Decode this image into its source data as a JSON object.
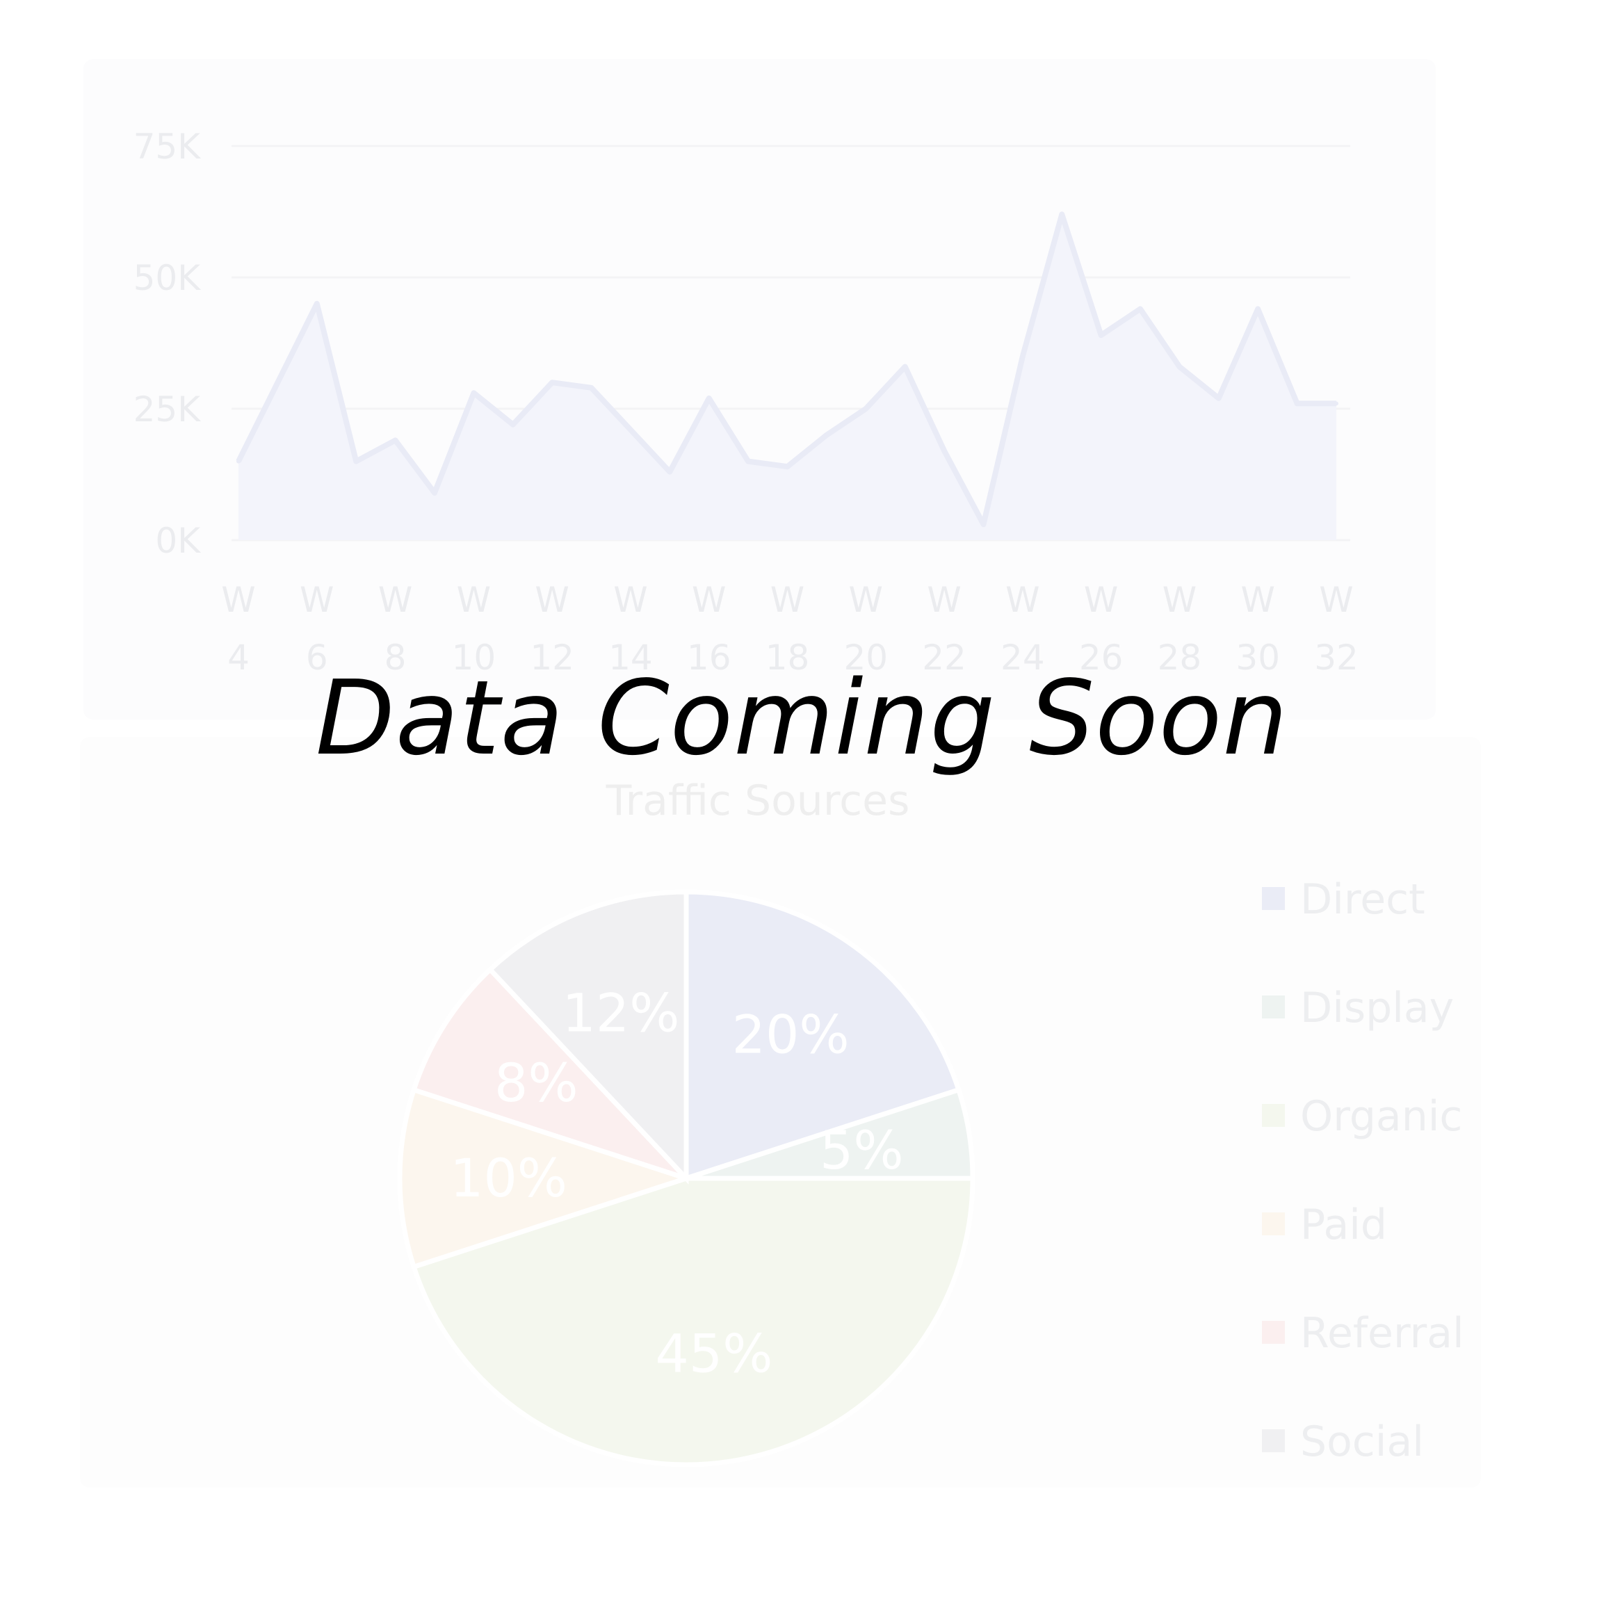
{
  "overlay_message": "Data Coming Soon",
  "chart_data": [
    {
      "type": "area",
      "y_ticks": [
        "0K",
        "25K",
        "50K",
        "75K"
      ],
      "ylim": [
        0,
        75000
      ],
      "x_prefix": "W",
      "x_tick_values": [
        4,
        6,
        8,
        10,
        12,
        14,
        16,
        18,
        20,
        22,
        24,
        26,
        28,
        30,
        32
      ],
      "x": [
        4,
        5,
        6,
        7,
        8,
        9,
        10,
        11,
        12,
        13,
        14,
        15,
        16,
        17,
        18,
        19,
        20,
        21,
        22,
        23,
        24,
        25,
        26,
        27,
        28,
        29,
        30,
        31,
        32
      ],
      "values": [
        15000,
        30000,
        45000,
        15000,
        19000,
        9000,
        28000,
        22000,
        30000,
        29000,
        21000,
        13000,
        27000,
        15000,
        14000,
        20000,
        25000,
        33000,
        17000,
        3000,
        35000,
        62000,
        39000,
        44000,
        33000,
        27000,
        44000,
        26000,
        26000
      ],
      "grid": true,
      "colors": {
        "fill": "#f3f4fb",
        "line": "#e9ebf6",
        "grid": "#f3f3f5"
      }
    },
    {
      "type": "pie",
      "subtitle": "Traffic Sources",
      "slices": [
        {
          "name": "Direct",
          "value": 20,
          "label": "20%",
          "color": "#eaecf6"
        },
        {
          "name": "Display",
          "value": 5,
          "label": "5%",
          "color": "#eef3f1"
        },
        {
          "name": "Organic",
          "value": 45,
          "label": "45%",
          "color": "#f4f7ee"
        },
        {
          "name": "Paid",
          "value": 10,
          "label": "10%",
          "color": "#fcf6ee"
        },
        {
          "name": "Referral",
          "value": 8,
          "label": "8%",
          "color": "#fbefef"
        },
        {
          "name": "Social",
          "value": 12,
          "label": "12%",
          "color": "#f0f0f2"
        }
      ],
      "legend": [
        "Direct",
        "Display",
        "Organic",
        "Paid",
        "Referral",
        "Social"
      ],
      "legend_position": "right"
    }
  ]
}
